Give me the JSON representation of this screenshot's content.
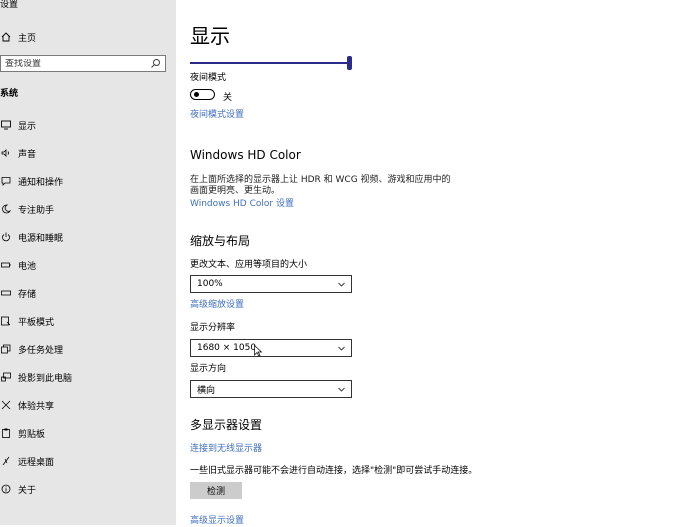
{
  "app": {
    "title": "设置"
  },
  "sidebar": {
    "home_label": "主页",
    "search_placeholder": "查找设置",
    "section": "系统",
    "items": [
      {
        "label": "显示",
        "icon": "monitor-icon"
      },
      {
        "label": "声音",
        "icon": "speaker-icon"
      },
      {
        "label": "通知和操作",
        "icon": "notification-icon"
      },
      {
        "label": "专注助手",
        "icon": "moon-icon"
      },
      {
        "label": "电源和睡眠",
        "icon": "power-icon"
      },
      {
        "label": "电池",
        "icon": "battery-icon"
      },
      {
        "label": "存储",
        "icon": "storage-icon"
      },
      {
        "label": "平板模式",
        "icon": "tablet-icon"
      },
      {
        "label": "多任务处理",
        "icon": "multitask-icon"
      },
      {
        "label": "投影到此电脑",
        "icon": "project-icon"
      },
      {
        "label": "体验共享",
        "icon": "share-icon"
      },
      {
        "label": "剪贴板",
        "icon": "clipboard-icon"
      },
      {
        "label": "远程桌面",
        "icon": "remote-desktop-icon"
      },
      {
        "label": "关于",
        "icon": "info-icon"
      }
    ]
  },
  "main": {
    "title": "显示",
    "brightness_level_percent": 100,
    "night_mode": {
      "label": "夜间模式",
      "state": "关",
      "link": "夜间模式设置"
    },
    "hd_color": {
      "heading": "Windows HD Color",
      "description": "在上面所选择的显示器上让 HDR 和 WCG 视频、游戏和应用中的画面更明亮、更生动。",
      "link": "Windows HD Color 设置"
    },
    "scale": {
      "heading": "缩放与布局",
      "size_label": "更改文本、应用等项目的大小",
      "size_value": "100%",
      "advanced_link": "高级缩放设置",
      "resolution_label": "显示分辨率",
      "resolution_value": "1680 × 1050",
      "orientation_label": "显示方向",
      "orientation_value": "横向"
    },
    "multi": {
      "heading": "多显示器设置",
      "wireless_link": "连接到无线显示器",
      "note": "一些旧式显示器可能不会进行自动连接，选择\"检测\"即可尝试手动连接。",
      "detect_button": "检测",
      "advanced_link": "高级显示设置"
    }
  }
}
